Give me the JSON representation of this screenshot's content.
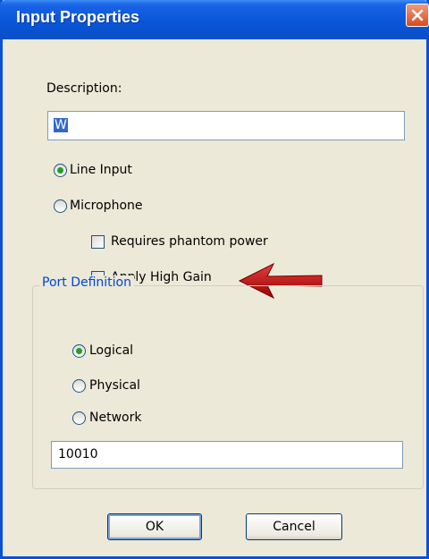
{
  "window": {
    "title": "Input Properties",
    "close_icon": "close-icon"
  },
  "description": {
    "label": "Description:",
    "value": "W"
  },
  "input_type": {
    "line_input_label": "Line Input",
    "line_input_selected": true,
    "microphone_label": "Microphone",
    "microphone_selected": false
  },
  "microphone_options": {
    "phantom_power_label": "Requires phantom power",
    "phantom_power_checked": false,
    "high_gain_label": "Apply High Gain",
    "high_gain_checked": false
  },
  "port_definition": {
    "title": "Port Definition",
    "logical_label": "Logical",
    "logical_selected": true,
    "physical_label": "Physical",
    "network_label": "Network",
    "port_value": "10010"
  },
  "buttons": {
    "ok_label": "OK",
    "cancel_label": "Cancel"
  },
  "annotation": {
    "arrow_icon": "red-arrow-icon",
    "arrow_color": "#c00000"
  },
  "colors": {
    "titlebar": "#0856d8",
    "window_bg": "#ece9d8",
    "group_title": "#0046d5",
    "radio_dot": "#21a121"
  }
}
